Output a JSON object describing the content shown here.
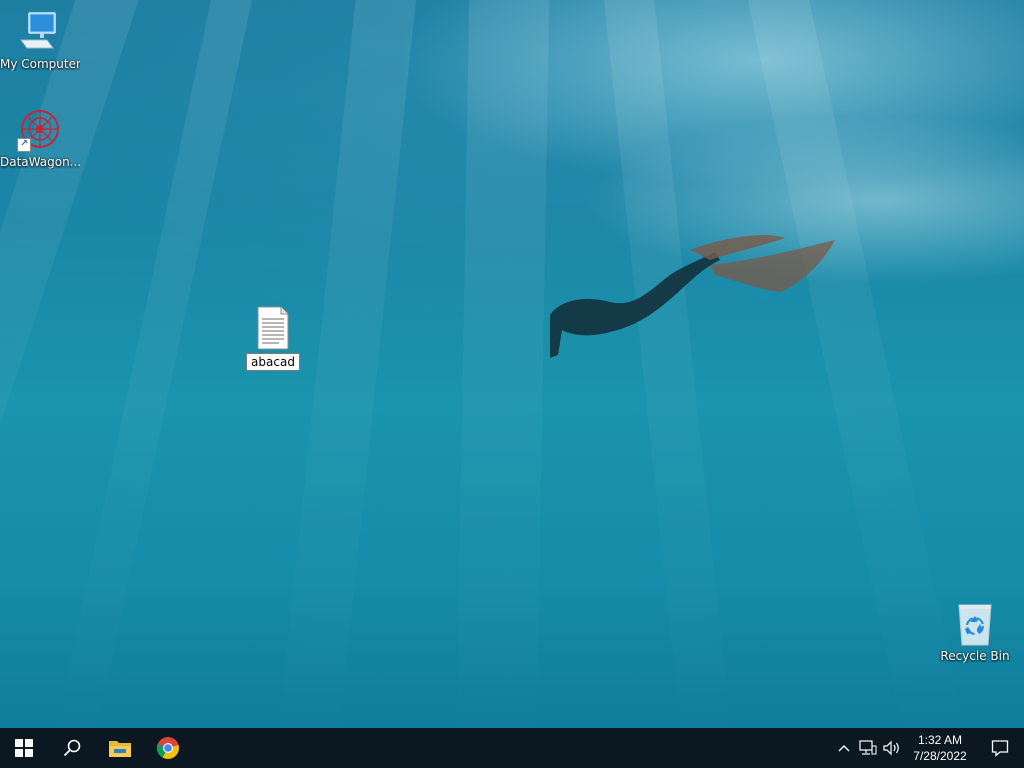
{
  "desktop": {
    "icons": [
      {
        "label": "My Computer",
        "icon": "computer-icon"
      },
      {
        "label": "DataWagon...",
        "icon": "datawagon-icon"
      },
      {
        "label": "abacad",
        "icon": "text-file-icon"
      },
      {
        "label": "Recycle Bin",
        "icon": "recycle-bin-icon"
      }
    ]
  },
  "taskbar": {
    "start": {
      "icon": "windows-logo-icon"
    },
    "search": {
      "icon": "search-icon"
    },
    "pinned": [
      {
        "icon": "file-explorer-icon"
      },
      {
        "icon": "chrome-icon"
      }
    ],
    "tray": {
      "icons": [
        "chevron-up-icon",
        "network-icon",
        "volume-icon"
      ],
      "time": "1:32 AM",
      "date": "7/28/2022",
      "notification_icon": "notification-icon"
    }
  },
  "colors": {
    "taskbar": "#0b1822",
    "water_top": "#1f7fa3",
    "water_bottom": "#0f7d9c"
  }
}
